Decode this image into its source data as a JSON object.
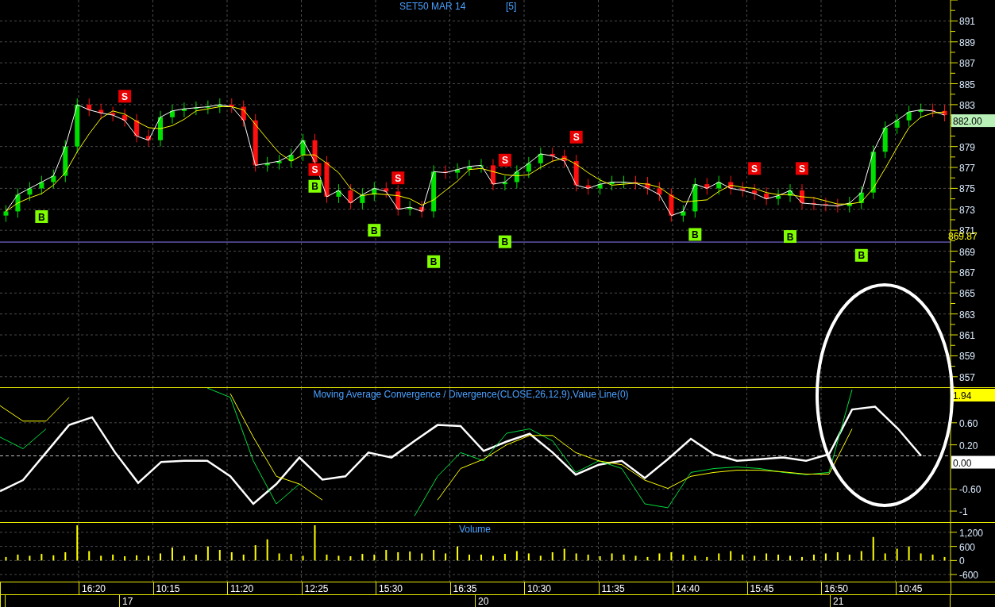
{
  "title": "SET50 MAR 14",
  "interval": "[5]",
  "price_panel": {
    "current_price": "882.00",
    "chart_data": {
      "type": "candlestick",
      "grid": true,
      "ylim": [
        856,
        893
      ],
      "yticks": [
        857,
        859,
        861,
        863,
        865,
        867,
        869,
        871,
        873,
        875,
        877,
        879,
        883,
        885,
        887,
        889,
        891
      ],
      "ohlc": [
        [
          872.4,
          873.4,
          871.8,
          872.8
        ],
        [
          872.8,
          875.0,
          872.2,
          874.4
        ],
        [
          874.4,
          875.6,
          873.8,
          875
        ],
        [
          875,
          876.2,
          874.4,
          875.6
        ],
        [
          875.6,
          876.8,
          875,
          876.2
        ],
        [
          876.2,
          879.6,
          875.6,
          879
        ],
        [
          879,
          883.6,
          878.4,
          883
        ],
        [
          883,
          883.6,
          881.9,
          882.5
        ],
        [
          882.5,
          883.1,
          881.6,
          882.2
        ],
        [
          882.2,
          882.8,
          881.4,
          882
        ],
        [
          882,
          882.6,
          880.9,
          881.5
        ],
        [
          881.5,
          882.1,
          879.4,
          880
        ],
        [
          880,
          880.6,
          879,
          879.6
        ],
        [
          879.6,
          882.4,
          879,
          881.8
        ],
        [
          881.8,
          883,
          881.2,
          882.4
        ],
        [
          882.4,
          883.2,
          881.8,
          882.6
        ],
        [
          882.6,
          883.3,
          882,
          882.7
        ],
        [
          882.7,
          883.4,
          882.1,
          882.8
        ],
        [
          882.8,
          883.6,
          882.2,
          883
        ],
        [
          883,
          883.6,
          882.2,
          882.8
        ],
        [
          882.8,
          883.4,
          880.9,
          881.5
        ],
        [
          881.5,
          882.1,
          876.6,
          877.2
        ],
        [
          877.2,
          878,
          876.6,
          877.4
        ],
        [
          877.4,
          878.2,
          876.8,
          877.6
        ],
        [
          877.6,
          878.8,
          877,
          878.2
        ],
        [
          878.2,
          880.2,
          877.6,
          879.6
        ],
        [
          879.6,
          880.2,
          876.9,
          877.5
        ],
        [
          877.5,
          878.1,
          873.6,
          874.2
        ],
        [
          874.2,
          875.4,
          873.6,
          874.8
        ],
        [
          874.8,
          875.4,
          873,
          873.6
        ],
        [
          873.6,
          875,
          873,
          874.4
        ],
        [
          874.4,
          875.6,
          873.8,
          875
        ],
        [
          875,
          875.6,
          874.1,
          874.7
        ],
        [
          874.7,
          875.3,
          872.4,
          873
        ],
        [
          873,
          873.8,
          872.4,
          873.2
        ],
        [
          873.2,
          873.8,
          872.2,
          872.8
        ],
        [
          872.8,
          877.2,
          872.2,
          876.6
        ],
        [
          876.6,
          877.2,
          875.9,
          876.5
        ],
        [
          876.5,
          877.4,
          875.9,
          876.8
        ],
        [
          876.8,
          877.7,
          876.2,
          877.1
        ],
        [
          877.1,
          877.8,
          876.5,
          877.2
        ],
        [
          877.2,
          877.8,
          874.8,
          875.4
        ],
        [
          875.4,
          876.2,
          874.8,
          875.6
        ],
        [
          875.6,
          877.2,
          875,
          876.6
        ],
        [
          876.6,
          878,
          876,
          877.4
        ],
        [
          877.4,
          878.9,
          876.8,
          878.3
        ],
        [
          878.3,
          878.9,
          877.5,
          878.1
        ],
        [
          878.1,
          878.7,
          877,
          877.6
        ],
        [
          877.6,
          878.2,
          874.7,
          875.3
        ],
        [
          875.3,
          875.9,
          874.4,
          875
        ],
        [
          875,
          876,
          874.4,
          875.4
        ],
        [
          875.4,
          876.2,
          874.8,
          875.6
        ],
        [
          875.6,
          876.2,
          875,
          875.6
        ],
        [
          875.6,
          876.2,
          874.9,
          875.5
        ],
        [
          875.5,
          876.1,
          874.4,
          875
        ],
        [
          875,
          875.6,
          873.8,
          874.4
        ],
        [
          874.4,
          875,
          871.8,
          872.4
        ],
        [
          872.4,
          873.4,
          871.8,
          872.8
        ],
        [
          872.8,
          876,
          872.2,
          875.4
        ],
        [
          875.4,
          876,
          874.4,
          875
        ],
        [
          875,
          876.2,
          874.4,
          875.6
        ],
        [
          875.6,
          876.2,
          874.4,
          875
        ],
        [
          875,
          875.6,
          874.2,
          874.8
        ],
        [
          874.8,
          875.4,
          873.9,
          874.5
        ],
        [
          874.5,
          875.1,
          873.4,
          874
        ],
        [
          874,
          874.9,
          873.4,
          874.3
        ],
        [
          874.3,
          875.4,
          873.7,
          874.8
        ],
        [
          874.8,
          875.4,
          873,
          873.6
        ],
        [
          873.6,
          874.2,
          872.9,
          873.5
        ],
        [
          873.5,
          874.1,
          872.8,
          873.4
        ],
        [
          873.4,
          874,
          872.7,
          873.3
        ],
        [
          873.3,
          874.2,
          872.7,
          873.6
        ],
        [
          873.6,
          875.2,
          873,
          874.6
        ],
        [
          874.6,
          879.1,
          874,
          878.5
        ],
        [
          878.5,
          881.4,
          877.9,
          880.8
        ],
        [
          880.8,
          882.1,
          880.2,
          881.5
        ],
        [
          881.5,
          882.9,
          880.9,
          882.3
        ],
        [
          882.3,
          883.1,
          881.7,
          882.5
        ],
        [
          882.5,
          883.1,
          881.8,
          882.4
        ],
        [
          882.4,
          883,
          881.4,
          882
        ]
      ],
      "ref_lines": [
        {
          "axis": "y",
          "value": 869.87,
          "label": "869.87"
        }
      ],
      "series": [
        {
          "type": "scatter",
          "name": "B",
          "color": "#80ff00",
          "values": [
            null,
            null,
            null,
            872.3,
            null,
            null,
            null,
            null,
            null,
            null,
            null,
            null,
            null,
            null,
            null,
            null,
            null,
            null,
            null,
            null,
            null,
            null,
            null,
            null,
            null,
            null,
            875.2,
            null,
            null,
            null,
            null,
            871,
            null,
            null,
            null,
            null,
            868,
            null,
            null,
            null,
            null,
            null,
            869.9,
            null,
            null,
            null,
            null,
            null,
            null,
            null,
            null,
            null,
            null,
            null,
            null,
            null,
            null,
            null,
            870.6,
            null,
            null,
            null,
            null,
            null,
            null,
            null,
            870.4,
            null,
            null,
            null,
            null,
            null,
            868.6,
            null,
            null,
            null,
            null,
            null,
            null,
            null
          ]
        },
        {
          "type": "scatter",
          "name": "S",
          "color": "#e80000",
          "values": [
            null,
            null,
            null,
            null,
            null,
            null,
            null,
            null,
            null,
            null,
            883.8,
            null,
            null,
            null,
            null,
            null,
            null,
            null,
            null,
            null,
            null,
            null,
            null,
            null,
            null,
            null,
            876.8,
            null,
            null,
            null,
            null,
            null,
            null,
            876,
            null,
            null,
            null,
            null,
            null,
            null,
            null,
            null,
            877.7,
            null,
            null,
            null,
            null,
            null,
            879.9,
            null,
            null,
            null,
            null,
            null,
            null,
            null,
            null,
            null,
            null,
            null,
            null,
            null,
            null,
            876.9,
            null,
            null,
            null,
            876.9,
            null,
            null,
            null,
            null,
            null,
            null,
            null,
            null,
            null,
            null,
            null,
            null
          ]
        },
        {
          "type": "line",
          "color": "#ffffff",
          "values": [
            872.8,
            874.4,
            875,
            875.6,
            876.2,
            879,
            883,
            882.5,
            882.2,
            882,
            881.5,
            880,
            879.6,
            881.8,
            882.4,
            882.6,
            882.7,
            882.8,
            883,
            882.8,
            881.5,
            877.2,
            877.4,
            877.6,
            878.2,
            879.6,
            877.5,
            874.2,
            874.8,
            873.6,
            874.4,
            875,
            874.7,
            873,
            873.2,
            872.8,
            876.6,
            876.5,
            876.8,
            877.1,
            877.2,
            875.4,
            875.6,
            876.6,
            877.4,
            878.3,
            878.1,
            877.6,
            875.3,
            875,
            875.4,
            875.6,
            875.6,
            875.5,
            875,
            874.4,
            872.4,
            872.8,
            875.4,
            875,
            875.6,
            875,
            874.8,
            874.5,
            874,
            874.3,
            874.8,
            873.6,
            873.5,
            873.4,
            873.3,
            873.6,
            874.6,
            878.5,
            880.8,
            881.5,
            882.3,
            882.5,
            882.4,
            882
          ]
        },
        {
          "type": "line",
          "color": "#ffff00",
          "values": [
            872.8,
            873.6,
            874.1,
            874.5,
            875.3,
            876.5,
            878.5,
            880.2,
            881.7,
            882.4,
            882.1,
            881.4,
            880.8,
            880.7,
            881,
            881.6,
            882.4,
            882.6,
            882.8,
            882.8,
            882.5,
            881.1,
            879.7,
            878.4,
            877.6,
            878.2,
            878.2,
            877.4,
            876.5,
            875,
            874.3,
            874.5,
            874.4,
            874.3,
            874,
            873.4,
            873.9,
            874.8,
            875.7,
            876.8,
            876.9,
            876.6,
            876.3,
            876.2,
            876.3,
            877,
            877.6,
            877.9,
            877.3,
            876.5,
            875.8,
            875.3,
            875.4,
            875.5,
            875.4,
            875.1,
            874.3,
            873.7,
            873.8,
            873.9,
            874.7,
            875.3,
            875.1,
            875,
            874.6,
            874.4,
            874.4,
            874.2,
            874.1,
            873.8,
            873.5,
            873.5,
            873.7,
            875,
            876.9,
            878.9,
            880.8,
            881.8,
            882.2,
            882.3
          ]
        }
      ]
    }
  },
  "macd_panel": {
    "label": "Moving Average Convergence / Divergence(CLOSE,26,12,9),Value Line(0)",
    "signal_value": "1.94",
    "chart_data": {
      "type": "line",
      "grid": true,
      "ylim": [
        -1.2,
        1.23
      ],
      "yticks": [
        {
          "value": 0.6,
          "label": "0.60"
        },
        {
          "value": 0.2,
          "label": "0.20"
        },
        {
          "value": -0.6,
          "label": "-0.60"
        },
        {
          "value": -1,
          "label": "-1"
        }
      ],
      "ref_lines": [
        {
          "axis": "y",
          "value": 0,
          "label": "0.00"
        }
      ],
      "series": [
        {
          "color": "#ffffff",
          "values": [
            -0.64,
            -0.44,
            0.06,
            0.56,
            0.7,
            0.06,
            -0.49,
            -0.11,
            -0.09,
            -0.09,
            -0.37,
            -0.87,
            -0.51,
            -0.03,
            -0.43,
            -0.37,
            0.06,
            -0.03,
            0.27,
            0.56,
            0.54,
            0.09,
            0.26,
            0.4,
            0.06,
            -0.34,
            -0.16,
            -0.09,
            -0.4,
            -0.06,
            0.31,
            0.03,
            -0.09,
            -0.06,
            -0.03,
            -0.09,
            0.03,
            0.84,
            0.89,
            0.49,
            0.0
          ]
        },
        {
          "color": "#00e040",
          "values": [
            0.34,
            0.13,
            0.49,
            null,
            null,
            null,
            null,
            null,
            null,
            1.23,
            1.06,
            -0.09,
            -0.87,
            -0.51,
            null,
            null,
            null,
            null,
            -1.09,
            -0.37,
            0.06,
            -0.09,
            0.41,
            0.49,
            0.27,
            -0.3,
            -0.09,
            -0.23,
            -0.87,
            -0.94,
            -0.3,
            -0.23,
            -0.2,
            -0.23,
            -0.3,
            -0.34,
            -0.3,
            1.2,
            null,
            null,
            null
          ]
        },
        {
          "color": "#ffff00",
          "values": [
            0.91,
            0.63,
            0.63,
            1.06,
            null,
            null,
            null,
            null,
            null,
            null,
            1.13,
            0.34,
            -0.37,
            -0.51,
            -0.8,
            null,
            null,
            null,
            null,
            -0.8,
            -0.23,
            -0.06,
            0.2,
            0.37,
            0.37,
            0.06,
            -0.09,
            -0.16,
            -0.44,
            -0.59,
            -0.37,
            -0.3,
            -0.26,
            -0.26,
            -0.29,
            -0.33,
            -0.33,
            0.49,
            null,
            null,
            null
          ]
        }
      ]
    }
  },
  "volume_panel": {
    "label": "Volume",
    "chart_data": {
      "type": "bar",
      "grid": true,
      "ylim": [
        -900,
        1600
      ],
      "yticks": [
        {
          "value": 1200,
          "label": "1,200"
        },
        {
          "value": 600,
          "label": "600"
        },
        {
          "value": 0,
          "label": "0"
        },
        {
          "value": -600,
          "label": "-600"
        }
      ],
      "series": [
        {
          "color": "#ffff00",
          "values": [
            150,
            250,
            200,
            280,
            220,
            350,
            1500,
            400,
            200,
            250,
            180,
            220,
            200,
            300,
            550,
            200,
            250,
            600,
            450,
            350,
            250,
            650,
            900,
            300,
            280,
            200,
            1500,
            250,
            200,
            180,
            280,
            250,
            450,
            350,
            380,
            300,
            450,
            300,
            600,
            250,
            250,
            200,
            280,
            400,
            300,
            200,
            350,
            500,
            300,
            250,
            180,
            300,
            250,
            200,
            150,
            300,
            350,
            250,
            200,
            150,
            300,
            400,
            250,
            200,
            300,
            250,
            200,
            150,
            250,
            300,
            350,
            250,
            400,
            1000,
            300,
            500,
            600,
            300,
            250,
            150
          ]
        }
      ]
    }
  },
  "time_axis": {
    "times": [
      "16:20",
      "10:15",
      "11:20",
      "12:25",
      "15:30",
      "16:35",
      "10:30",
      "11:35",
      "14:40",
      "15:45",
      "16:50",
      "10:45"
    ],
    "dates": [
      "17",
      "20",
      "21"
    ]
  }
}
